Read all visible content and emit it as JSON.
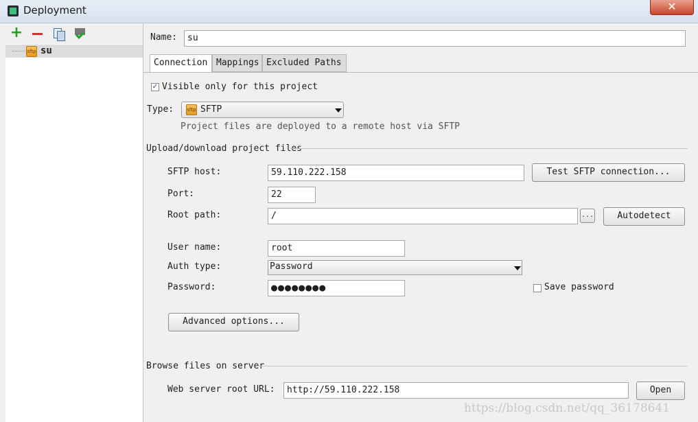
{
  "window": {
    "title": "Deployment",
    "icon": "intellij-app-icon",
    "close_label": "✕"
  },
  "sidebar": {
    "toolbar": {
      "add": "+",
      "icons": [
        "add-icon",
        "remove-icon",
        "copy-icon",
        "use-as-default-icon"
      ]
    },
    "servers": [
      {
        "name": "su",
        "icon_text": "sftp"
      }
    ]
  },
  "form": {
    "name_label": "Name:",
    "name_value": "su",
    "tabs": [
      "Connection",
      "Mappings",
      "Excluded Paths"
    ],
    "active_tab": "Connection",
    "visible_only_label": "Visible only for this project",
    "visible_only_checked": true,
    "check_mark": "✓",
    "type_label": "Type:",
    "type_value": "SFTP",
    "type_icon_text": "sftp",
    "type_hint": "Project files are deployed to a remote host via SFTP",
    "upload_section": "Upload/download project files",
    "host_label": "SFTP host:",
    "host_value": "59.110.222.158",
    "test_button": "Test SFTP connection...",
    "port_label": "Port:",
    "port_value": "22",
    "root_path_label": "Root path:",
    "root_path_value": "/",
    "browse_button": "...",
    "autodetect_button": "Autodetect",
    "user_label": "User name:",
    "user_value": "root",
    "auth_label": "Auth type:",
    "auth_value": "Password",
    "password_label": "Password:",
    "password_value": "●●●●●●●●",
    "save_password_label": "Save password",
    "save_password_checked": false,
    "advanced_button": "Advanced options...",
    "browse_section": "Browse files on server",
    "web_url_label": "Web server root URL:",
    "web_url_value": "http://59.110.222.158",
    "open_button": "Open"
  },
  "watermark": "https://blog.csdn.net/qq_36178641",
  "colors": {
    "accent_add": "#1fa51f",
    "accent_remove": "#d83030",
    "close_red": "#c8452b",
    "sftp_orange": "#e59a21"
  }
}
